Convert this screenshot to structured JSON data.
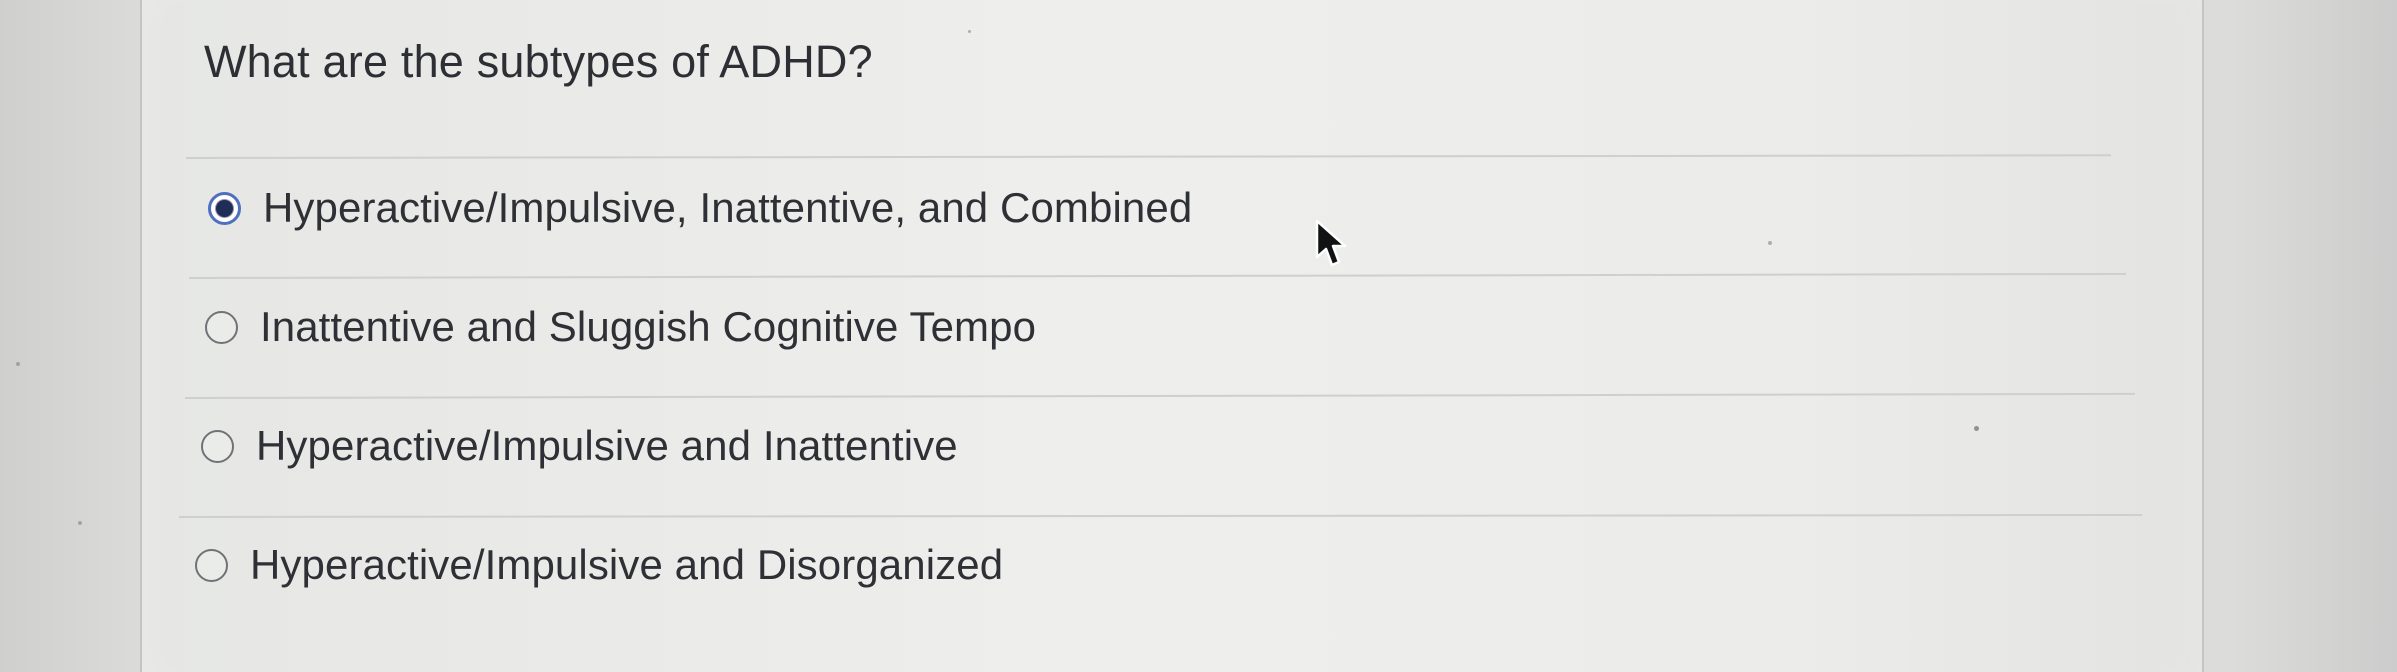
{
  "question": {
    "text": "What are the subtypes of ADHD?"
  },
  "options": [
    {
      "label": "Hyperactive/Impulsive, Inattentive, and Combined",
      "selected": true
    },
    {
      "label": "Inattentive and Sluggish Cognitive Tempo",
      "selected": false
    },
    {
      "label": "Hyperactive/Impulsive and Inattentive",
      "selected": false
    },
    {
      "label": "Hyperactive/Impulsive and Disorganized",
      "selected": false
    }
  ],
  "colors": {
    "text": "#2e3035",
    "selected_radio_border": "#4f6fbf",
    "selected_radio_fill": "#1f2d58",
    "divider": "#cfd0ce",
    "card": "#eeeeec"
  },
  "icons": {
    "selected_radio": "radio-selected-icon",
    "unselected_radio": "radio-unselected-icon",
    "cursor": "mouse-pointer-icon"
  }
}
